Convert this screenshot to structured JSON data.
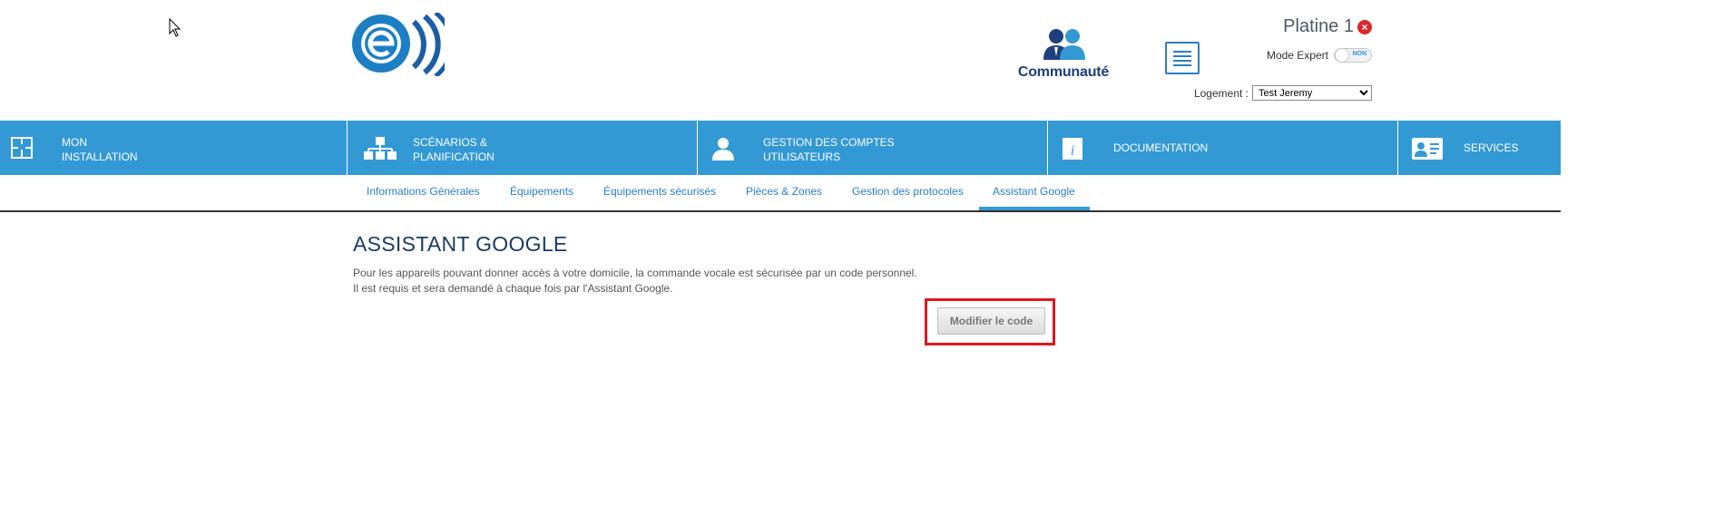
{
  "header": {
    "community_label": "Communauté",
    "platine_label": "Platine 1",
    "mode_expert_label": "Mode Expert",
    "mode_expert_toggle": "NON",
    "logement_label": "Logement :",
    "logement_selected": "Test Jeremy"
  },
  "main_nav": {
    "items": [
      {
        "line1": "MON",
        "line2": "INSTALLATION"
      },
      {
        "line1": "SCÉNARIOS &",
        "line2": "PLANIFICATION"
      },
      {
        "line1": "GESTION DES COMPTES",
        "line2": "UTILISATEURS"
      },
      {
        "line1": "DOCUMENTATION"
      },
      {
        "line1": "SERVICES"
      }
    ]
  },
  "sub_nav": {
    "tabs": [
      "Informations Générales",
      "Équipements",
      "Équipements sécurisés",
      "Pièces & Zones",
      "Gestion des protocoles",
      "Assistant Google"
    ],
    "active": "Assistant Google"
  },
  "content": {
    "title": "ASSISTANT GOOGLE",
    "desc_line1": "Pour les appareils pouvant donner accès à votre domicile, la commande vocale est sécurisée par un code personnel.",
    "desc_line2": "Il est requis et sera demandé à chaque fois par l'Assistant Google.",
    "button_label": "Modifier le code"
  },
  "colors": {
    "nav_blue": "#3399d5",
    "link_blue": "#2a7fc0",
    "title_navy": "#1a3a66",
    "highlight_red": "#e0151f"
  }
}
